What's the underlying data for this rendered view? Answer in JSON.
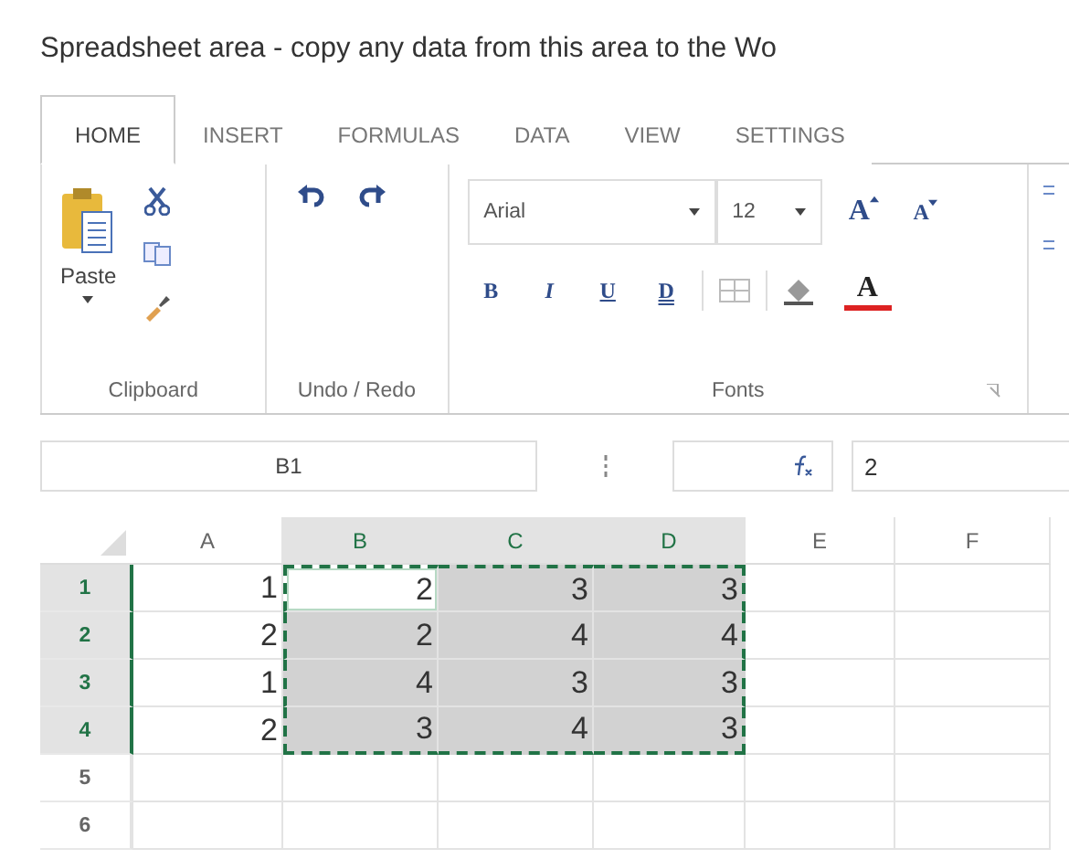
{
  "title": "Spreadsheet area - copy any data from this area to the Wo",
  "tabs": [
    {
      "label": "HOME",
      "selected": true
    },
    {
      "label": "INSERT",
      "selected": false
    },
    {
      "label": "FORMULAS",
      "selected": false
    },
    {
      "label": "DATA",
      "selected": false
    },
    {
      "label": "VIEW",
      "selected": false
    },
    {
      "label": "SETTINGS",
      "selected": false
    }
  ],
  "ribbon": {
    "clipboard": {
      "name": "Clipboard",
      "paste": "Paste"
    },
    "undo_redo": {
      "name": "Undo / Redo"
    },
    "fonts": {
      "name": "Fonts",
      "font": "Arial",
      "size": "12",
      "grow": "A",
      "shrink": "A",
      "format_buttons": [
        "B",
        "I",
        "U",
        "D"
      ],
      "font_color": "A"
    }
  },
  "formula_bar": {
    "name_box": "B1",
    "formula": "2"
  },
  "columns": [
    {
      "label": "A",
      "selected": false
    },
    {
      "label": "B",
      "selected": true
    },
    {
      "label": "C",
      "selected": true
    },
    {
      "label": "D",
      "selected": true
    },
    {
      "label": "E",
      "selected": false
    },
    {
      "label": "F",
      "selected": false
    }
  ],
  "rows": [
    {
      "header": "1",
      "selected": true,
      "cells": [
        {
          "value": "1",
          "selected": false,
          "active": false
        },
        {
          "value": "2",
          "selected": true,
          "active": true
        },
        {
          "value": "3",
          "selected": true,
          "active": false
        },
        {
          "value": "3",
          "selected": true,
          "active": false
        }
      ]
    },
    {
      "header": "2",
      "selected": true,
      "cells": [
        {
          "value": "2",
          "selected": false,
          "active": false
        },
        {
          "value": "2",
          "selected": true,
          "active": false
        },
        {
          "value": "4",
          "selected": true,
          "active": false
        },
        {
          "value": "4",
          "selected": true,
          "active": false
        }
      ]
    },
    {
      "header": "3",
      "selected": true,
      "cells": [
        {
          "value": "1",
          "selected": false,
          "active": false
        },
        {
          "value": "4",
          "selected": true,
          "active": false
        },
        {
          "value": "3",
          "selected": true,
          "active": false
        },
        {
          "value": "3",
          "selected": true,
          "active": false
        }
      ]
    },
    {
      "header": "4",
      "selected": true,
      "cells": [
        {
          "value": "2",
          "selected": false,
          "active": false
        },
        {
          "value": "3",
          "selected": true,
          "active": false
        },
        {
          "value": "4",
          "selected": true,
          "active": false
        },
        {
          "value": "3",
          "selected": true,
          "active": false
        }
      ]
    },
    {
      "header": "5",
      "selected": false,
      "cells": []
    },
    {
      "header": "6",
      "selected": false,
      "cells": []
    }
  ]
}
